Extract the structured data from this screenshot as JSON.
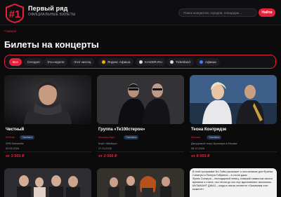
{
  "header": {
    "logo_text": "#1",
    "brand_title": "Первый ряд",
    "brand_sub": "Официальные билеты",
    "brand_sub2": "",
    "search_placeholder": "Поиск концертов, городов, площадок...",
    "find_label": "Найти"
  },
  "breadcrumb": "Главная",
  "page_title": "Билеты на концерты",
  "filters": [
    {
      "label": "Все",
      "active": true
    },
    {
      "label": "Сегодня",
      "active": false
    },
    {
      "label": "Эта неделя",
      "active": false
    },
    {
      "label": "Этот месяц",
      "active": false
    },
    {
      "label": "Яндекс Афиша",
      "active": false,
      "dot_color": "#f5b000"
    },
    {
      "label": "KASSIR.RU",
      "active": false,
      "dot_color": "#d8d8de"
    },
    {
      "label": "Ticketland",
      "active": false,
      "dot_color": "#d8d8de"
    },
    {
      "label": "Афиша",
      "active": false,
      "dot_color": "#3b7bff"
    }
  ],
  "cards": [
    {
      "title": "Честный",
      "tag": "Rehkab",
      "badge": "Ticketland",
      "venue": "SPB Messebile",
      "date": "02.09.2026",
      "price": "от 3 000 ₽"
    },
    {
      "title": "Группа «Те100стерон»",
      "tag": "Екатеринбург",
      "badge": "Ticketland",
      "venue": "Клуб «Мебиус»",
      "date": "27.11.2026",
      "price": "от 2 000 ₽"
    },
    {
      "title": "Теона Контридзе",
      "tag": "Москва",
      "badge": "Ticketland",
      "venue": "Дворцовый театр Булевара в Москве",
      "date": "08.10.2026",
      "price": "от 8 000 ₽"
    }
  ],
  "text_card": [
    "В этой программе Бо-Тайм расскажет о постановках для Фрэнка Синатры и Питера Гэбриела – в стиле джаз.",
    "Фрэнк Синатра – легендарный певец, ставший символом своего времени и стиля, чьи песни до сих пор вдохновляют миллионы.",
    "МУЗЫКАНТ ДЖАЗ – когда в пятом сегменте «Занимаем этот момент!»"
  ],
  "colors": {
    "accent": "#e8213b",
    "background": "#0b0b0c"
  }
}
